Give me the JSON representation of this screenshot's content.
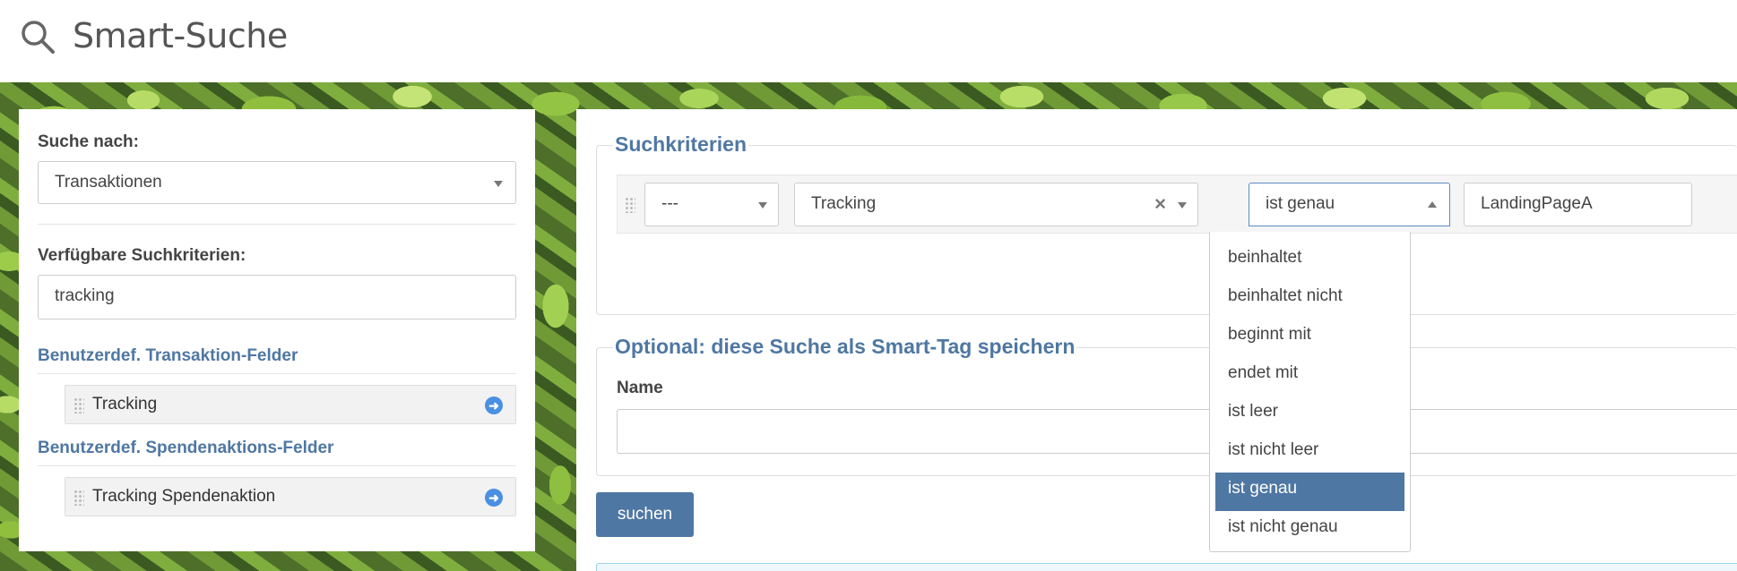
{
  "header": {
    "title": "Smart-Suche"
  },
  "left": {
    "search_by_label": "Suche nach:",
    "search_by_value": "Transaktionen",
    "available_label": "Verfügbare Suchkriterien:",
    "filter_value": "tracking",
    "groups": [
      {
        "title": "Benutzerdef. Transaktion-Felder",
        "items": [
          "Tracking"
        ]
      },
      {
        "title": "Benutzerdef. Spendenaktions-Felder",
        "items": [
          "Tracking Spendenaktion"
        ]
      }
    ]
  },
  "criteria": {
    "legend": "Suchkriterien",
    "connector": "---",
    "field": "Tracking",
    "operator": "ist genau",
    "value": "LandingPageA",
    "operator_options": [
      "beinhaltet",
      "beinhaltet nicht",
      "beginnt mit",
      "endet mit",
      "ist leer",
      "ist nicht leer",
      "ist genau",
      "ist nicht genau"
    ],
    "selected_option": "ist genau"
  },
  "smarttag": {
    "legend": "Optional: diese Suche als Smart-Tag speichern",
    "name_label": "Name",
    "name_value": ""
  },
  "actions": {
    "search_button": "suchen"
  },
  "icons": [
    "search-icon",
    "drag-handle-icon",
    "arrow-right-icon",
    "clear-icon",
    "chevron-down-icon",
    "chevron-up-icon"
  ],
  "colors": {
    "accent": "#4f77a3",
    "link_icon": "#4a90e2"
  }
}
